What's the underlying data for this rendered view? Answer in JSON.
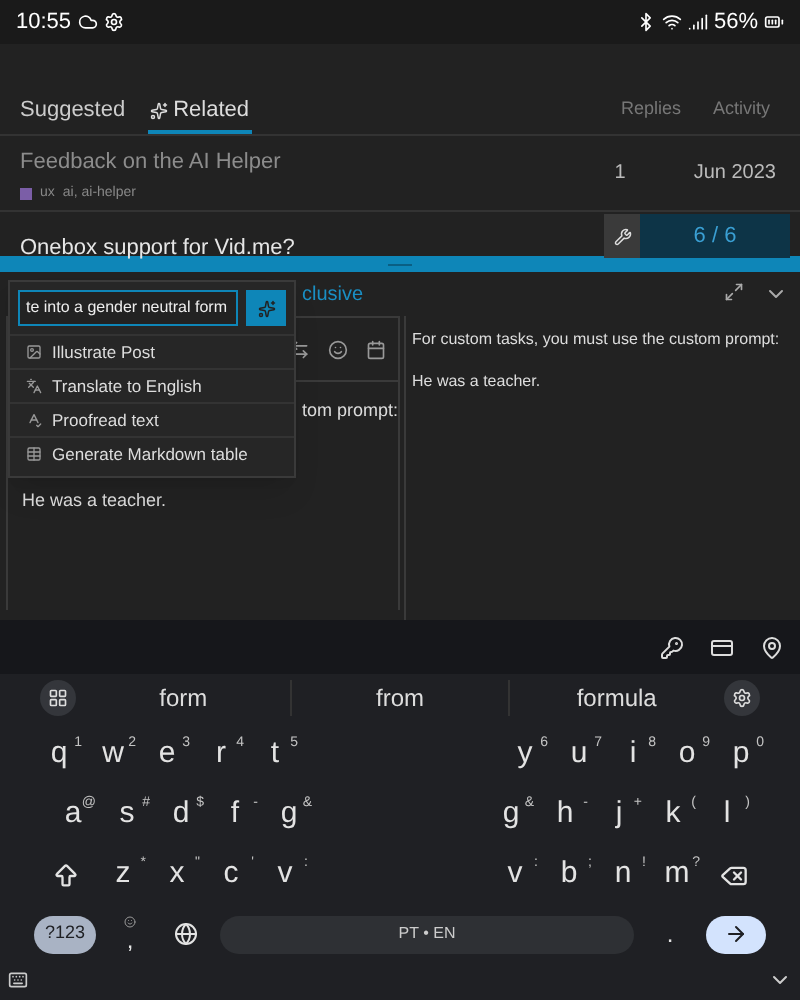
{
  "status_bar": {
    "time": "10:55",
    "battery": "56%"
  },
  "topic_tabs": [
    {
      "label": "Suggested",
      "selected": false
    },
    {
      "label": "Related",
      "selected": true
    }
  ],
  "columns": [
    "Replies",
    "Activity"
  ],
  "topics": [
    {
      "title": "Feedback on the AI Helper",
      "visited": true,
      "category": "ux",
      "color": "#7b5ea7",
      "tags": "ai, ai-helper",
      "replies": "1",
      "activity": "Jun 2023"
    },
    {
      "title": "Onebox support for Vid.me?",
      "visited": false
    }
  ],
  "progress": {
    "counter": "6 / 6"
  },
  "composer": {
    "toolbar_text": "clusive",
    "ai_prompt": {
      "value": "te into a gender neutral form"
    },
    "ai_menu": [
      "Illustrate Post",
      "Translate to English",
      "Proofread text",
      "Generate Markdown table"
    ],
    "editor_lines": [
      "tom prompt:",
      "He was a teacher."
    ],
    "preview_lines": [
      "For custom tasks, you must use the custom prompt:",
      "He was a teacher."
    ]
  },
  "keyboard": {
    "suggestions": [
      "form",
      "from",
      "formula"
    ],
    "rows": [
      {
        "left": [
          {
            "label": "q",
            "hint": "1"
          },
          {
            "label": "w",
            "hint": "2"
          },
          {
            "label": "e",
            "hint": "3"
          },
          {
            "label": "r",
            "hint": "4"
          },
          {
            "label": "t",
            "hint": "5"
          }
        ],
        "right": [
          {
            "label": "y",
            "hint": "6"
          },
          {
            "label": "u",
            "hint": "7"
          },
          {
            "label": "i",
            "hint": "8"
          },
          {
            "label": "o",
            "hint": "9"
          },
          {
            "label": "p",
            "hint": "0"
          }
        ]
      },
      {
        "left": [
          {
            "label": "a",
            "hint": "@"
          },
          {
            "label": "s",
            "hint": "#"
          },
          {
            "label": "d",
            "hint": "$"
          },
          {
            "label": "f",
            "hint": "-"
          },
          {
            "label": "g",
            "hint": "&"
          }
        ],
        "right": [
          {
            "label": "g",
            "hint": "&"
          },
          {
            "label": "h",
            "hint": "-"
          },
          {
            "label": "j",
            "hint": "+"
          },
          {
            "label": "k",
            "hint": "("
          },
          {
            "label": "l",
            "hint": ")"
          }
        ]
      },
      {
        "left": [
          {
            "label": "z",
            "hint": "*"
          },
          {
            "label": "x",
            "hint": "\""
          },
          {
            "label": "c",
            "hint": "'"
          },
          {
            "label": "v",
            "hint": ":"
          }
        ],
        "right": [
          {
            "label": "v",
            "hint": ":"
          },
          {
            "label": "b",
            "hint": ";"
          },
          {
            "label": "n",
            "hint": "!"
          },
          {
            "label": "m",
            "hint": "?"
          }
        ]
      }
    ],
    "symbols_key": "?123",
    "comma_key": ",",
    "space_label": "PT • EN",
    "period_key": "."
  }
}
